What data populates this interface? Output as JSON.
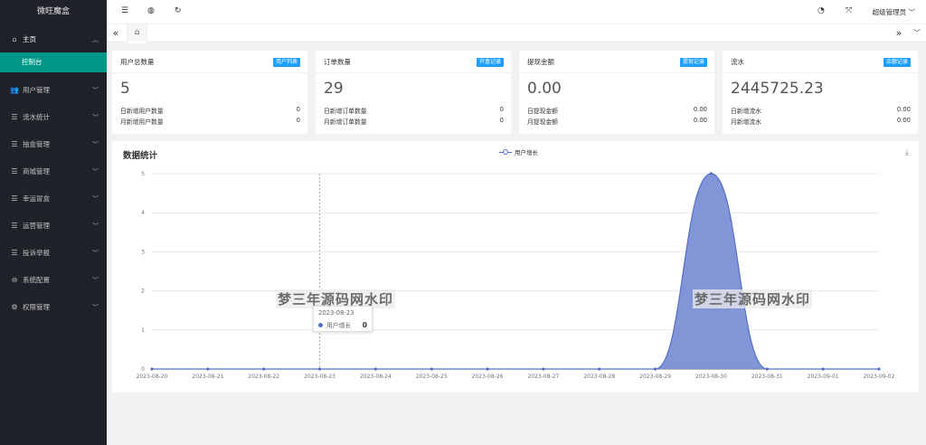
{
  "sidebar": {
    "brand": "微旺魔盒",
    "home": {
      "label": "主页",
      "icon": "home-icon"
    },
    "sub_items": [
      {
        "label": "控制台"
      }
    ],
    "items": [
      {
        "label": "用户管理",
        "icon": "users-icon"
      },
      {
        "label": "流水统计",
        "icon": "statistics-icon"
      },
      {
        "label": "抽盒管理",
        "icon": "box-icon"
      },
      {
        "label": "商城管理",
        "icon": "shop-icon"
      },
      {
        "label": "幸运冒盒",
        "icon": "lucky-box-icon"
      },
      {
        "label": "运营管理",
        "icon": "operation-icon"
      },
      {
        "label": "投诉举报",
        "icon": "complaint-icon"
      },
      {
        "label": "系统配置",
        "icon": "config-icon"
      },
      {
        "label": "权限管理",
        "icon": "permission-icon"
      }
    ]
  },
  "header": {
    "admin": "超级管理员"
  },
  "cards": [
    {
      "title": "用户总数量",
      "badge": "用户列表",
      "value": "5",
      "rows": [
        {
          "label": "日新增用户数量",
          "value": "0"
        },
        {
          "label": "月新增用户数量",
          "value": "0"
        }
      ]
    },
    {
      "title": "订单数量",
      "badge": "开盒记录",
      "value": "29",
      "rows": [
        {
          "label": "日新增订单数量",
          "value": "0"
        },
        {
          "label": "月新增订单数量",
          "value": "0"
        }
      ]
    },
    {
      "title": "提现金额",
      "badge": "提现记录",
      "value": "0.00",
      "rows": [
        {
          "label": "日提现金额",
          "value": "0.00"
        },
        {
          "label": "月提现金额",
          "value": "0.00"
        }
      ]
    },
    {
      "title": "流水",
      "badge": "余额记录",
      "value": "2445725.23",
      "rows": [
        {
          "label": "日新增流水",
          "value": "0.00"
        },
        {
          "label": "月新增流水",
          "value": "0.00"
        }
      ]
    }
  ],
  "panel": {
    "title": "数据统计"
  },
  "watermark": "梦三年源码网水印",
  "tooltip": {
    "date": "2023-08-23",
    "series": "用户增长",
    "value": "0"
  },
  "chart_data": {
    "type": "area",
    "x": [
      "2023-08-20",
      "2023-08-21",
      "2023-08-22",
      "2023-08-23",
      "2023-08-24",
      "2023-08-25",
      "2023-08-26",
      "2023-08-27",
      "2023-08-28",
      "2023-08-29",
      "2023-08-30",
      "2023-08-31",
      "2023-09-01",
      "2023-09-02"
    ],
    "series": [
      {
        "name": "用户增长",
        "values": [
          0,
          0,
          0,
          0,
          0,
          0,
          0,
          0,
          0,
          0,
          5,
          0,
          0,
          0
        ]
      }
    ],
    "yticks": [
      0,
      1,
      2,
      3,
      4,
      5
    ],
    "ylim": [
      0,
      5
    ],
    "smooth": true,
    "color": "#5470c6",
    "area_color": "#7b8fd4",
    "grid": true,
    "legend": "top-center"
  }
}
